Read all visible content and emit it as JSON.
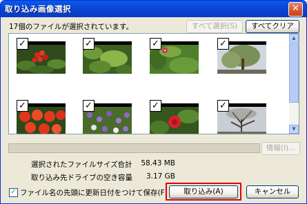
{
  "window": {
    "title": "取り込み画像選択",
    "close_glyph": "✕"
  },
  "header": {
    "count_label": "17個のファイルが選択されています。",
    "deselect_all_label": "すべて選択(S)",
    "select_all_label": "すべてクリア(C)"
  },
  "thumbnails": [
    {
      "checked": true,
      "subject": "red-berries"
    },
    {
      "checked": true,
      "subject": "green-shrub"
    },
    {
      "checked": true,
      "subject": "pink-flower"
    },
    {
      "checked": true,
      "subject": "tree"
    },
    {
      "checked": true,
      "subject": "red-flowers"
    },
    {
      "checked": true,
      "subject": "purple-flowers"
    },
    {
      "checked": true,
      "subject": "red-rose"
    },
    {
      "checked": true,
      "subject": "bare-tree"
    }
  ],
  "check_glyph": "✓",
  "info_button_label": "情報(I)...",
  "stats": {
    "size_label": "選択されたファイルサイズ合計",
    "size_value": "58.43 MB",
    "free_label": "取り込み先ドライブの空き容量",
    "free_value": "3.17 GB",
    "colon": ":"
  },
  "options": {
    "rename_checked": true,
    "rename_label": "ファイル名の先頭に更新日付をつけて保存(F)"
  },
  "buttons": {
    "import_label": "取り込み(A)",
    "cancel_label": "キャンセル"
  },
  "colors": {
    "title_blue": "#0a46d6",
    "highlight_red": "#e30000"
  }
}
